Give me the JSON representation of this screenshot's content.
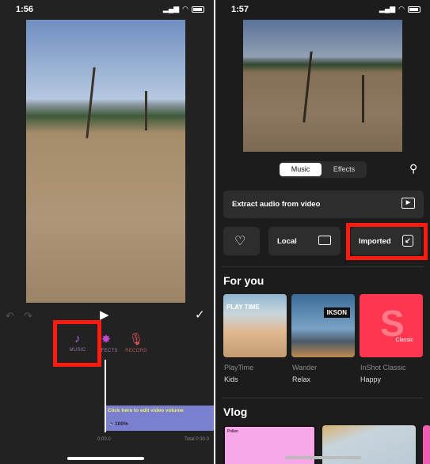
{
  "left": {
    "status_time": "1:56",
    "tools": [
      {
        "label": "MUSIC",
        "icon": "music-note-plus-icon"
      },
      {
        "label": "EFFECTS",
        "icon": "sparkle-plus-icon"
      },
      {
        "label": "RECORD",
        "icon": "microphone-plus-icon"
      }
    ],
    "clip": {
      "label": "Click here to edit video volume",
      "volume": "100%"
    },
    "time_current": "0:00.0",
    "time_total": "Total 0:30.0"
  },
  "right": {
    "status_time": "1:57",
    "tabs": [
      {
        "label": "Music",
        "active": true
      },
      {
        "label": "Effects",
        "active": false
      }
    ],
    "extract_label": "Extract audio from video",
    "local_label": "Local",
    "imported_label": "Imported",
    "for_you_title": "For you",
    "for_you": [
      {
        "title": "PlayTime",
        "genre": "Kids",
        "cover_text": "PLAY TIME"
      },
      {
        "title": "Wander",
        "genre": "Relax",
        "cover_text": "IKSON"
      },
      {
        "title": "InShot Classic",
        "genre": "Happy",
        "cover_text": "Classic"
      }
    ],
    "vlog_title": "Vlog",
    "vlog": [
      {
        "cover_text": "Pollen"
      }
    ]
  },
  "colors": {
    "highlight": "#ff1a12",
    "music_tool": "#b06ad8",
    "record_tool": "#e0505a",
    "clip": "#7b7fd0"
  }
}
